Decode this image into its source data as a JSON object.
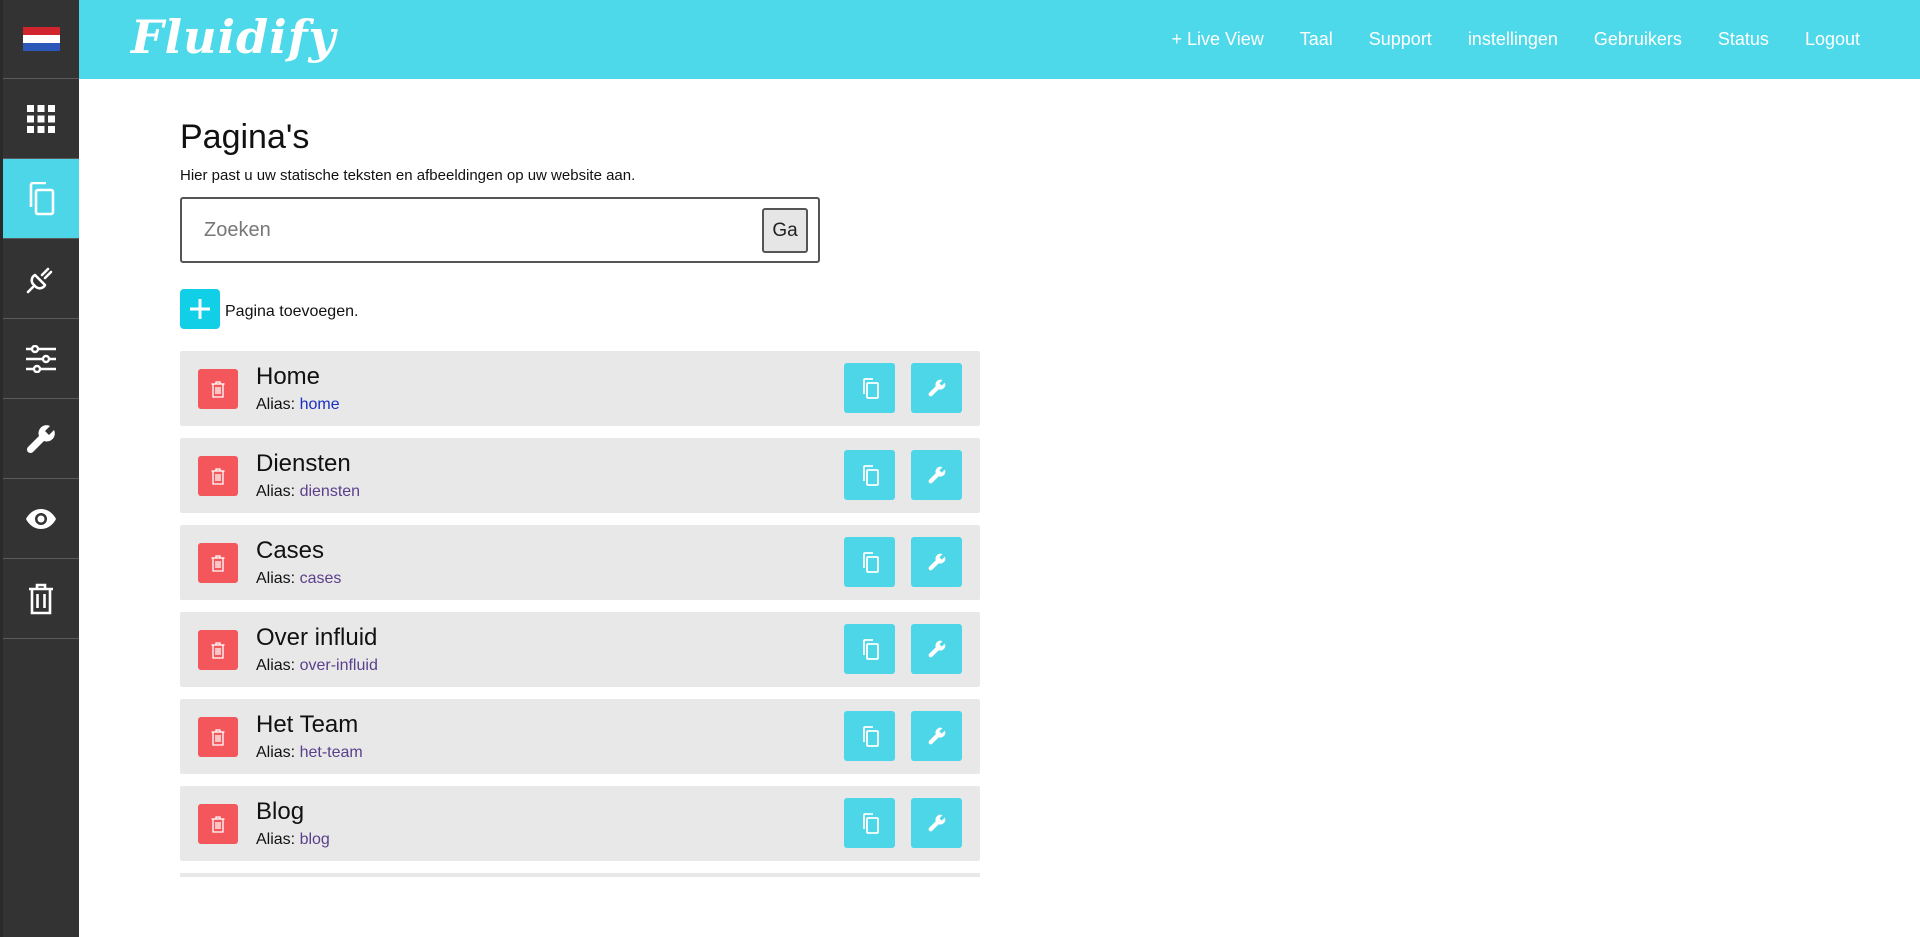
{
  "sidebar": {
    "flag_colors": [
      "#d2242e",
      "#ffffff",
      "#2a57b8"
    ],
    "items": [
      {
        "icon": "grid-icon"
      },
      {
        "icon": "pages-copy-icon",
        "active": true
      },
      {
        "icon": "plug-icon"
      },
      {
        "icon": "sliders-icon"
      },
      {
        "icon": "wrench-icon"
      },
      {
        "icon": "eye-icon"
      },
      {
        "icon": "trash-icon"
      }
    ]
  },
  "header": {
    "logo": "Fluidify",
    "nav": [
      "+ Live View",
      "Taal",
      "Support",
      "instellingen",
      "Gebruikers",
      "Status",
      "Logout"
    ]
  },
  "main": {
    "title": "Pagina's",
    "subtitle": "Hier past u uw statische teksten en afbeeldingen op uw website aan.",
    "search": {
      "placeholder": "Zoeken",
      "button": "Ga"
    },
    "add_label": "Pagina toevoegen.",
    "alias_label": "Alias:",
    "pages": [
      {
        "title": "Home",
        "alias": "home"
      },
      {
        "title": "Diensten",
        "alias": "diensten"
      },
      {
        "title": "Cases",
        "alias": "cases"
      },
      {
        "title": "Over influid",
        "alias": "over-influid"
      },
      {
        "title": "Het Team",
        "alias": "het-team"
      },
      {
        "title": "Blog",
        "alias": "blog"
      }
    ]
  },
  "colors": {
    "accent": "#4dd9e9",
    "sidebar": "#333333",
    "delete": "#f4575b",
    "add": "#12cfe8",
    "row_bg": "#e8e8e8"
  }
}
